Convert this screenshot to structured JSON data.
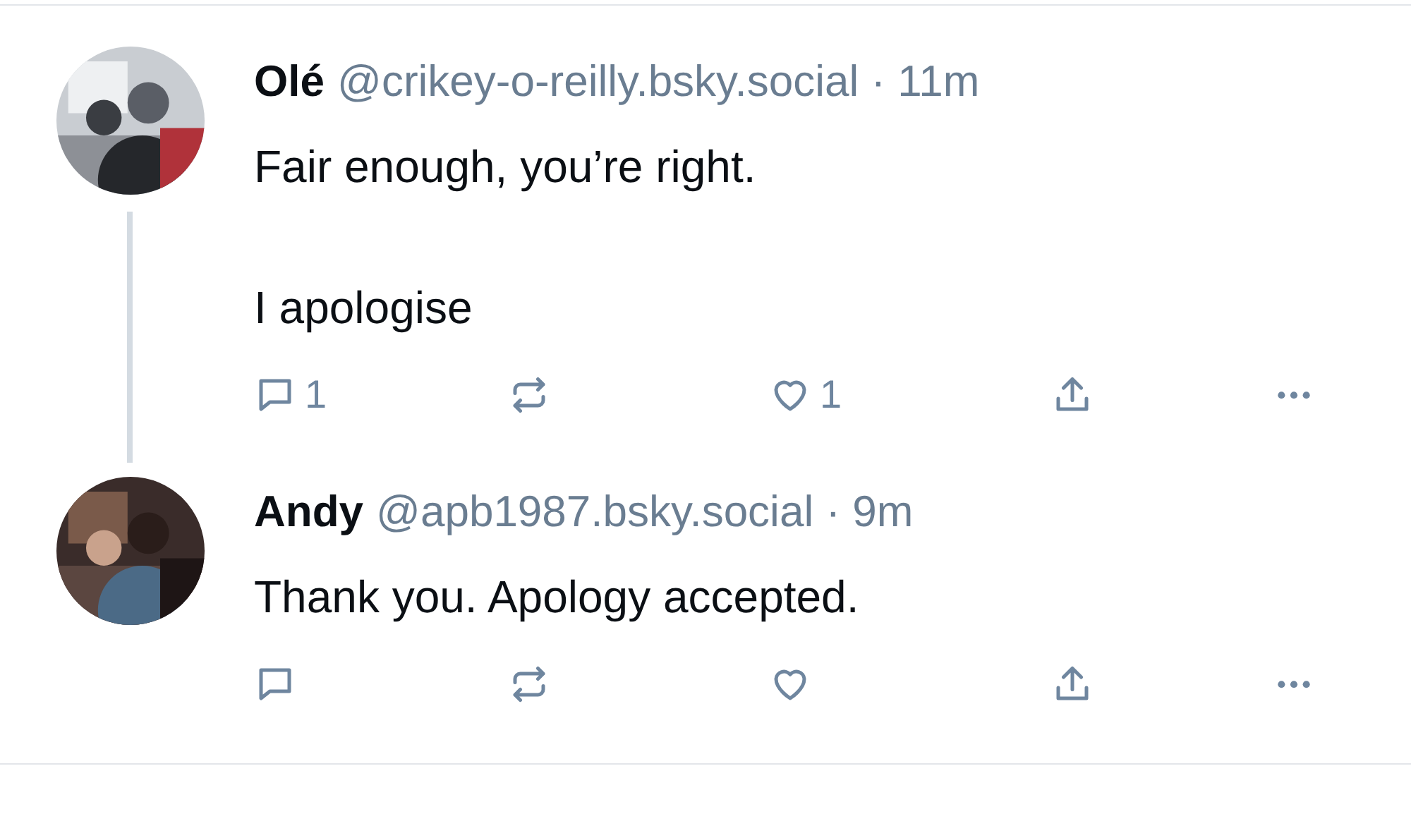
{
  "posts": [
    {
      "author": "Olé",
      "meta": "@crikey-o-reilly.bsky.social · 11m",
      "paragraphs": [
        "Fair enough, you’re right.",
        "I apologise"
      ],
      "reply_count": "1",
      "like_count": "1",
      "thread_line": true
    },
    {
      "author": "Andy",
      "meta": "@apb1987.bsky.social · 9m",
      "paragraphs": [
        "Thank you. Apology accepted."
      ]
    }
  ]
}
